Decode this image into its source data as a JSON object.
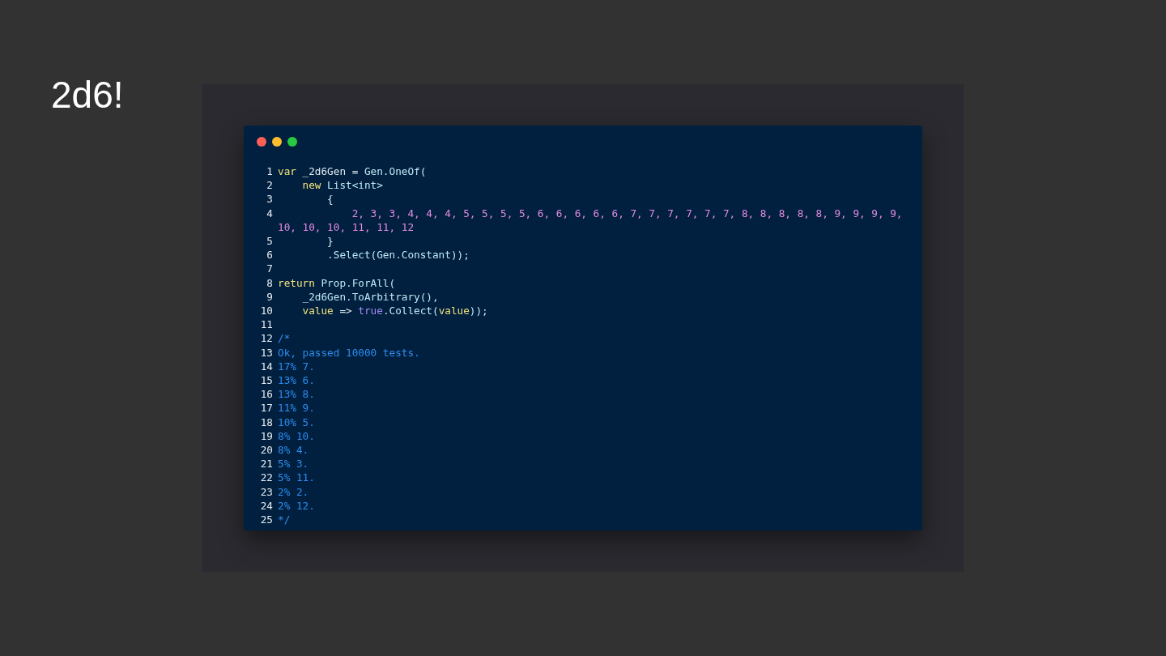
{
  "slide_title": "2d6!",
  "code_window": {
    "lines": [
      {
        "number": "1",
        "tokens": [
          {
            "kind": "keyword",
            "text": "var"
          },
          {
            "kind": "plain",
            "text": " _2d6Gen = "
          },
          {
            "kind": "ident",
            "text": "Gen.OneOf("
          }
        ]
      },
      {
        "number": "2",
        "tokens": [
          {
            "kind": "keyword",
            "text": "    new"
          },
          {
            "kind": "ident",
            "text": " List<int>"
          }
        ]
      },
      {
        "number": "3",
        "tokens": [
          {
            "kind": "plain",
            "text": "        {"
          }
        ]
      },
      {
        "number": "4",
        "tokens": [
          {
            "kind": "number",
            "text": "            2, 3, 3, 4, 4, 4, 5, 5, 5, 5, 6, 6, 6, 6, 6, 7, 7, 7, 7, 7, 7, 8, 8, 8, 8, 8, 9, 9, 9, 9, 10, 10, 10, 11, 11, 12"
          }
        ]
      },
      {
        "number": "5",
        "tokens": [
          {
            "kind": "plain",
            "text": "        }"
          }
        ]
      },
      {
        "number": "6",
        "tokens": [
          {
            "kind": "ident",
            "text": "        .Select(Gen.Constant));"
          }
        ]
      },
      {
        "number": "7"
      },
      {
        "number": "8",
        "tokens": [
          {
            "kind": "keyword",
            "text": "return"
          },
          {
            "kind": "ident",
            "text": " Prop.ForAll("
          }
        ]
      },
      {
        "number": "9",
        "tokens": [
          {
            "kind": "ident",
            "text": "    _2d6Gen.ToArbitrary(),"
          }
        ]
      },
      {
        "number": "10",
        "tokens": [
          {
            "kind": "keyword",
            "text": "    value"
          },
          {
            "kind": "plain",
            "text": " => "
          },
          {
            "kind": "literal",
            "text": "true"
          },
          {
            "kind": "ident",
            "text": ".Collect("
          },
          {
            "kind": "keyword",
            "text": "value"
          },
          {
            "kind": "ident",
            "text": "));"
          }
        ]
      },
      {
        "number": "11"
      },
      {
        "number": "12",
        "tokens": [
          {
            "kind": "comment",
            "text": "/*"
          }
        ]
      },
      {
        "number": "13",
        "tokens": [
          {
            "kind": "comment",
            "text": "Ok, passed 10000 tests."
          }
        ]
      },
      {
        "number": "14",
        "tokens": [
          {
            "kind": "comment",
            "text": "17% 7."
          }
        ]
      },
      {
        "number": "15",
        "tokens": [
          {
            "kind": "comment",
            "text": "13% 6."
          }
        ]
      },
      {
        "number": "16",
        "tokens": [
          {
            "kind": "comment",
            "text": "13% 8."
          }
        ]
      },
      {
        "number": "17",
        "tokens": [
          {
            "kind": "comment",
            "text": "11% 9."
          }
        ]
      },
      {
        "number": "18",
        "tokens": [
          {
            "kind": "comment",
            "text": "10% 5."
          }
        ]
      },
      {
        "number": "19",
        "tokens": [
          {
            "kind": "comment",
            "text": "8% 10."
          }
        ]
      },
      {
        "number": "20",
        "tokens": [
          {
            "kind": "comment",
            "text": "8% 4."
          }
        ]
      },
      {
        "number": "21",
        "tokens": [
          {
            "kind": "comment",
            "text": "5% 3."
          }
        ]
      },
      {
        "number": "22",
        "tokens": [
          {
            "kind": "comment",
            "text": "5% 11."
          }
        ]
      },
      {
        "number": "23",
        "tokens": [
          {
            "kind": "comment",
            "text": "2% 2."
          }
        ]
      },
      {
        "number": "24",
        "tokens": [
          {
            "kind": "comment",
            "text": "2% 12."
          }
        ]
      },
      {
        "number": "25",
        "tokens": [
          {
            "kind": "comment",
            "text": "*/"
          }
        ]
      }
    ]
  }
}
